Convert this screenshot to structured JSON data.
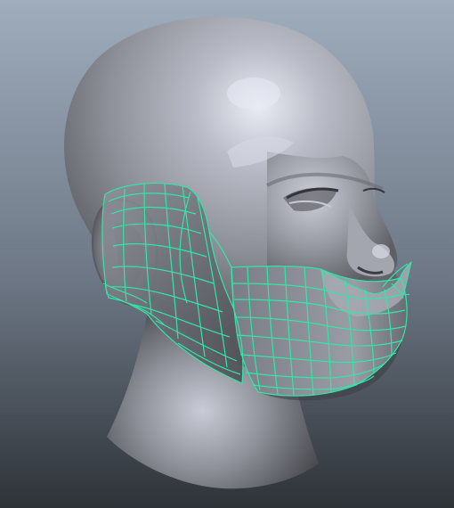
{
  "viewport": {
    "background_top": "#9fadbd",
    "background_bottom": "#2e3338"
  },
  "model": {
    "head_name": "head-mesh",
    "mask_name": "face-mask-mesh",
    "skin_light": "#d7dbe6",
    "skin_mid": "#9ea1a9",
    "skin_dark": "#4c4d53",
    "wireframe_color": "#31e6a8",
    "selected": true
  }
}
